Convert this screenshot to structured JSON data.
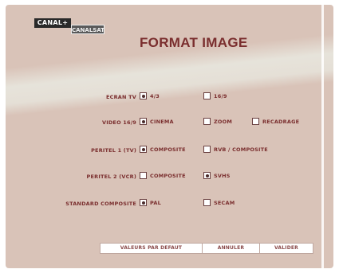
{
  "logo": {
    "brand": "CANAL+",
    "sub": "CANALSAT"
  },
  "title": "FORMAT IMAGE",
  "rows": [
    {
      "label": "ECRAN TV",
      "options": [
        {
          "label": "4/3",
          "checked": true
        },
        {
          "label": "16/9",
          "checked": false
        }
      ]
    },
    {
      "label": "VIDEO 16/9",
      "options": [
        {
          "label": "CINEMA",
          "checked": true
        },
        {
          "label": "ZOOM",
          "checked": false
        },
        {
          "label": "RECADRAGE",
          "checked": false
        }
      ]
    },
    {
      "label": "PERITEL 1 (TV)",
      "options": [
        {
          "label": "COMPOSITE",
          "checked": true
        },
        {
          "label": "RVB / COMPOSITE",
          "checked": false
        }
      ]
    },
    {
      "label": "PERITEL 2 (VCR)",
      "options": [
        {
          "label": "COMPOSITE",
          "checked": false
        },
        {
          "label": "SVHS",
          "checked": true
        }
      ]
    },
    {
      "label": "STANDARD COMPOSITE",
      "options": [
        {
          "label": "PAL",
          "checked": true
        },
        {
          "label": "SECAM",
          "checked": false
        }
      ]
    }
  ],
  "buttons": {
    "defaults": "VALEURS PAR DEFAUT",
    "cancel": "ANNULER",
    "confirm": "VALIDER"
  },
  "colors": {
    "panel": "#d9c3b8",
    "text": "#7a2e2e"
  }
}
